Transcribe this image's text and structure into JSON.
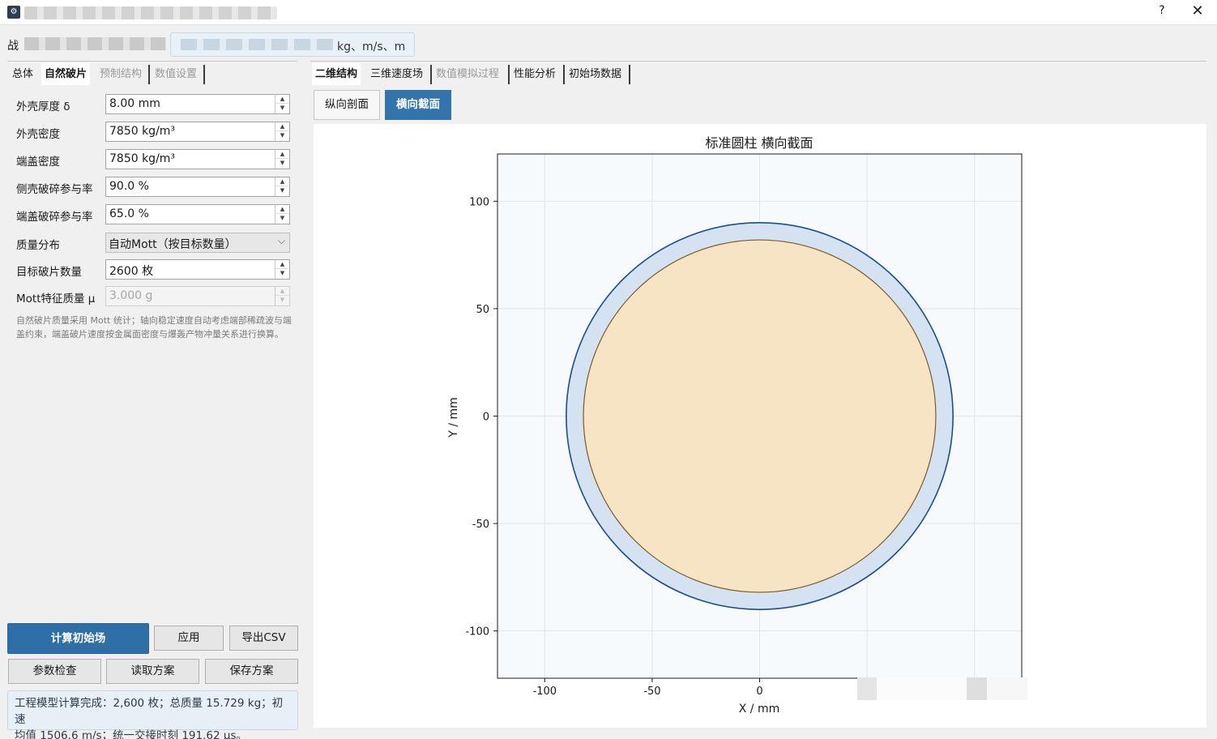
{
  "window": {
    "title_prefix": "战",
    "help_label": "?",
    "close_label": "✕",
    "icon": "app-icon"
  },
  "header": {
    "label_prefix": "战",
    "units_text": "kg、m/s、m"
  },
  "left_tabs": [
    {
      "label": "总体",
      "state": "normal"
    },
    {
      "label": "自然破片",
      "state": "active"
    },
    {
      "label": "预制结构",
      "state": "disabled"
    },
    {
      "label": "数值设置",
      "state": "disabled"
    }
  ],
  "form": {
    "shell_thickness": {
      "label": "外壳厚度 δ",
      "value": "8.00 mm"
    },
    "shell_density": {
      "label": "外壳密度",
      "value": "7850 kg/m³"
    },
    "cap_density": {
      "label": "端盖密度",
      "value": "7850 kg/m³"
    },
    "side_fragment_rate": {
      "label": "侧壳破碎参与率",
      "value": "90.0 %"
    },
    "cap_fragment_rate": {
      "label": "端盖破碎参与率",
      "value": "65.0 %"
    },
    "mass_distribution": {
      "label": "质量分布",
      "value": "自动Mott（按目标数量）"
    },
    "target_count": {
      "label": "目标破片数量",
      "value": "2600 枚"
    },
    "mott_mass": {
      "label": "Mott特征质量 μ",
      "value": "3.000 g"
    }
  },
  "help_text": "自然破片质量采用 Mott 统计；轴向稳定速度自动考虑端部稀疏波与端盖约束，端盖破片速度按金属面密度与爆轰产物冲量关系进行换算。",
  "buttons": {
    "compute": "计算初始场",
    "apply": "应用",
    "export_csv": "导出CSV",
    "param_check": "参数检查",
    "load_scheme": "读取方案",
    "save_scheme": "保存方案"
  },
  "status": {
    "line1": "工程模型计算完成：2,600 枚；总质量 15.729 kg；初速",
    "line2": "均值 1506.6 m/s；统一交接时刻 191.62 μs。"
  },
  "right_tabs": [
    {
      "label": "二维结构",
      "state": "active"
    },
    {
      "label": "三维速度场",
      "state": "normal"
    },
    {
      "label": "数值模拟过程",
      "state": "disabled"
    },
    {
      "label": "性能分析",
      "state": "normal"
    },
    {
      "label": "初始场数据",
      "state": "normal"
    }
  ],
  "view_tabs": [
    {
      "label": "纵向剖面",
      "state": "normal"
    },
    {
      "label": "横向截面",
      "state": "active"
    }
  ],
  "colors": {
    "accent": "#3474ad",
    "shell_fill": "#d4e2f1",
    "shell_stroke": "#1f4e86",
    "explosive_fill": "#f7e4c4",
    "explosive_stroke": "#7a5a2a",
    "plot_bg": "#f7fafd"
  },
  "chart_data": {
    "type": "cross-section",
    "title": "标准圆柱 横向截面",
    "xlabel": "X / mm",
    "ylabel": "Y / mm",
    "xlim": [
      -122,
      122
    ],
    "ylim": [
      -122,
      122
    ],
    "xticks": [
      -100,
      -50,
      0
    ],
    "yticks": [
      100,
      50,
      0,
      -50,
      -100
    ],
    "grid": true,
    "shapes": [
      {
        "name": "outer shell",
        "type": "circle",
        "cx": 0,
        "cy": 0,
        "r": 90
      },
      {
        "name": "explosive charge",
        "type": "circle",
        "cx": 0,
        "cy": 0,
        "r": 82
      }
    ]
  }
}
